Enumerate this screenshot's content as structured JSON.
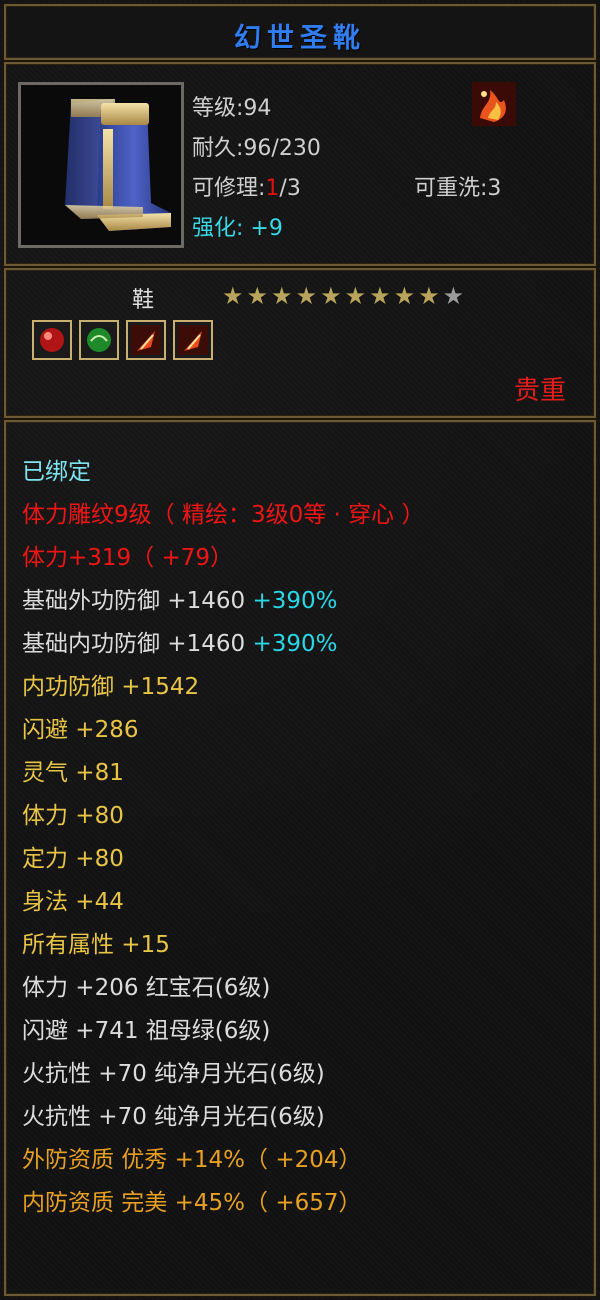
{
  "item": {
    "name": "幻世圣靴",
    "level_text": "等级:94",
    "durability_text": "耐久:96/230",
    "repair_label": "可修理:",
    "repair_current": "1",
    "repair_total": "/3",
    "rewash_text": "可重洗:3",
    "reinforce_label": "强化:",
    "reinforce_value": "+9",
    "slot": "鞋",
    "stars_filled": 9,
    "stars_total": 10,
    "gems": [
      "red-gem-icon",
      "green-gem-icon",
      "flame-gem-icon",
      "flame-gem-icon"
    ],
    "rarity": "贵重"
  },
  "stats": [
    {
      "text": "已绑定",
      "color": "#7fe3ef"
    },
    {
      "text": "体力雕纹9级（ 精绘：3级0等 · 穿心 ）",
      "color": "#f01515"
    },
    {
      "text": "体力+319（ +79）",
      "color": "#f01515"
    },
    {
      "text": "基础外功防御 +1460",
      "extra": "+390%",
      "color": "#dcdcdc"
    },
    {
      "text": "基础内功防御 +1460",
      "extra": "+390%",
      "color": "#dcdcdc"
    },
    {
      "text": "内功防御 +1542",
      "color": "#e8c545"
    },
    {
      "text": "闪避 +286",
      "color": "#e8c545"
    },
    {
      "text": "灵气 +81",
      "color": "#e8c545"
    },
    {
      "text": "体力 +80",
      "color": "#e8c545"
    },
    {
      "text": "定力 +80",
      "color": "#e8c545"
    },
    {
      "text": "身法 +44",
      "color": "#e8c545"
    },
    {
      "text": "所有属性 +15",
      "color": "#e8c545"
    },
    {
      "text": "体力 +206 红宝石(6级)",
      "color": "#dcdcdc"
    },
    {
      "text": "闪避 +741 祖母绿(6级)",
      "color": "#dcdcdc"
    },
    {
      "text": "火抗性 +70 纯净月光石(6级)",
      "color": "#dcdcdc"
    },
    {
      "text": "火抗性 +70 纯净月光石(6级)",
      "color": "#dcdcdc"
    },
    {
      "text": "外防资质  优秀 +14%（ +204）",
      "color": "#e8a021"
    },
    {
      "text": "内防资质  完美 +45%（ +657）",
      "color": "#e8a021"
    }
  ],
  "colors": {
    "title": "#2f7df0",
    "border": "#6b5a34",
    "reinforce": "#38d8e6",
    "rarity": "#e41c1c",
    "extra_percent": "#28d8e6"
  }
}
